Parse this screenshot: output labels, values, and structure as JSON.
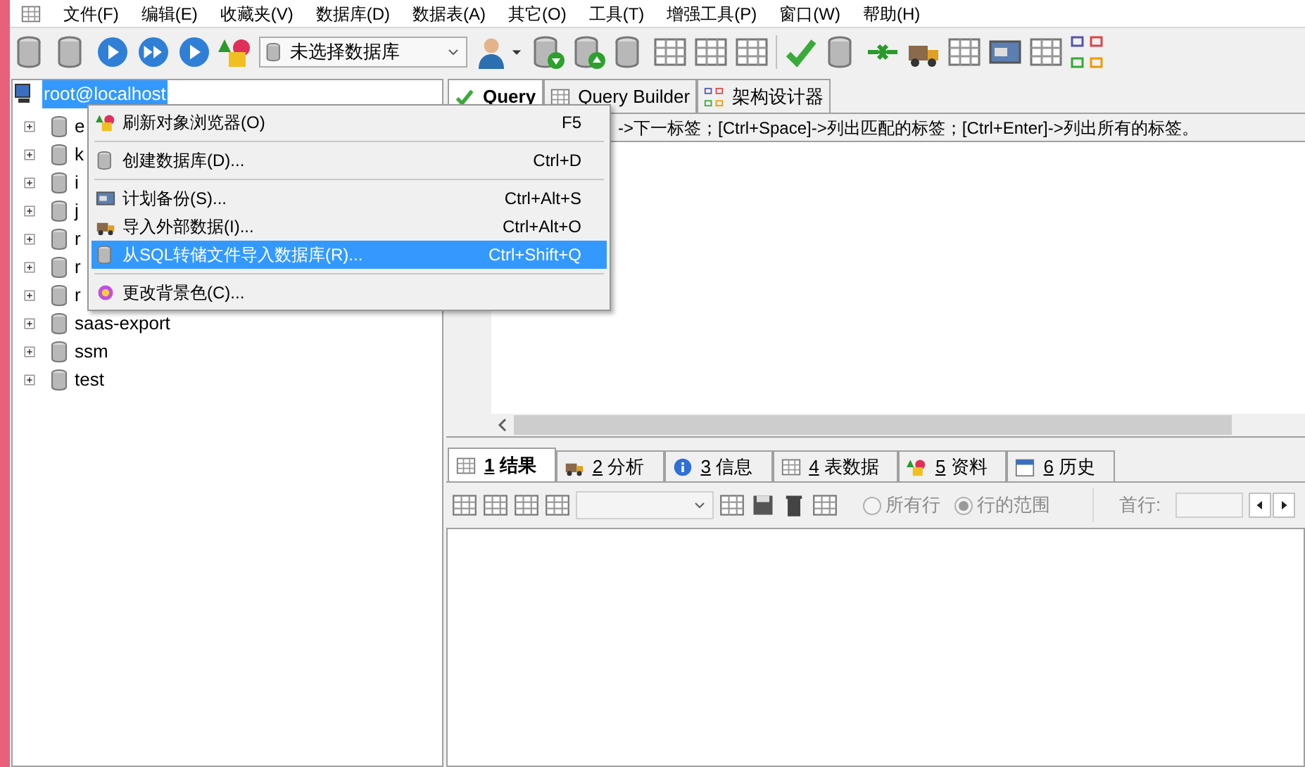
{
  "menu_bar": [
    "文件(F)",
    "编辑(E)",
    "收藏夹(V)",
    "数据库(D)",
    "数据表(A)",
    "其它(O)",
    "工具(T)",
    "增强工具(P)",
    "窗口(W)",
    "帮助(H)"
  ],
  "toolbar": {
    "database_select": "未选择数据库"
  },
  "tree": {
    "root": {
      "label": "root@localhost",
      "selected": true
    },
    "items": [
      {
        "label": "e"
      },
      {
        "label": "k"
      },
      {
        "label": "i"
      },
      {
        "label": "j"
      },
      {
        "label": "r"
      },
      {
        "label": "r"
      },
      {
        "label": "r"
      },
      {
        "label": "saas-export"
      },
      {
        "label": "ssm"
      },
      {
        "label": "test"
      }
    ]
  },
  "context_menu": {
    "items": [
      {
        "kind": "item",
        "label": "刷新对象浏览器(O)",
        "shortcut": "F5",
        "selected": false
      },
      {
        "kind": "separator"
      },
      {
        "kind": "item",
        "label": "创建数据库(D)...",
        "shortcut": "Ctrl+D",
        "selected": false
      },
      {
        "kind": "separator"
      },
      {
        "kind": "item",
        "label": "计划备份(S)...",
        "shortcut": "Ctrl+Alt+S",
        "selected": false
      },
      {
        "kind": "item",
        "label": "导入外部数据(I)...",
        "shortcut": "Ctrl+Alt+O",
        "selected": false
      },
      {
        "kind": "item",
        "label": "从SQL转储文件导入数据库(R)...",
        "shortcut": "Ctrl+Shift+Q",
        "selected": true
      },
      {
        "kind": "separator"
      },
      {
        "kind": "item",
        "label": "更改背景色(C)...",
        "selected": false
      }
    ]
  },
  "editor_tabs": [
    {
      "label": "Query",
      "selected": true
    },
    {
      "label": "Query Builder",
      "selected": false
    },
    {
      "label": "架构设计器",
      "selected": false
    }
  ],
  "hint": "->下一标签；[Ctrl+Space]->列出匹配的标签；[Ctrl+Enter]->列出所有的标签。",
  "result_tabs": [
    {
      "number": "1",
      "label": "结果",
      "selected": true
    },
    {
      "number": "2",
      "label": "分析",
      "selected": false
    },
    {
      "number": "3",
      "label": "信息",
      "selected": false
    },
    {
      "number": "4",
      "label": "表数据",
      "selected": false
    },
    {
      "number": "5",
      "label": "资料",
      "selected": false
    },
    {
      "number": "6",
      "label": "历史",
      "selected": false
    }
  ],
  "result_toolbar": {
    "radios": [
      {
        "label": "所有行",
        "selected": false,
        "disabled": true
      },
      {
        "label": "行的范围",
        "selected": true,
        "disabled": true
      }
    ],
    "first_row_label": "首行:"
  }
}
